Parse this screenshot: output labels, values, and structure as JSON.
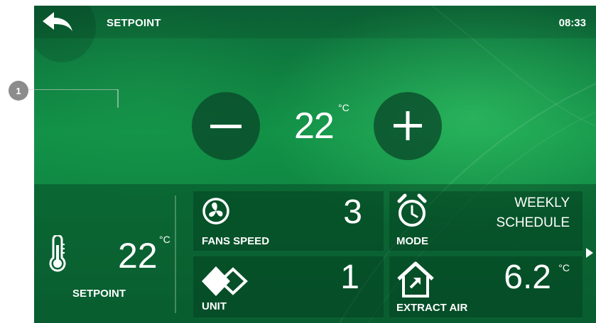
{
  "header": {
    "title": "SETPOINT",
    "time": "08:33"
  },
  "callout": {
    "number": "1"
  },
  "setpoint_control": {
    "value": "22",
    "unit": "°C"
  },
  "summary": {
    "setpoint_value": "22",
    "setpoint_unit": "°C",
    "setpoint_label": "SETPOINT"
  },
  "tiles": {
    "fans_speed": {
      "label": "FANS SPEED",
      "value": "3"
    },
    "mode": {
      "label": "MODE",
      "value_line1": "WEEKLY",
      "value_line2": "SCHEDULE"
    },
    "unit": {
      "label": "UNIT",
      "value": "1"
    },
    "extract_air": {
      "label": "EXTRACT AIR",
      "value": "6.2",
      "unit": "°C"
    }
  },
  "icons": {
    "back": "back-arrow-icon",
    "minus": "minus-icon",
    "plus": "plus-icon",
    "thermometer": "thermometer-icon",
    "fan": "fan-icon",
    "alarm_clock": "alarm-clock-icon",
    "unit": "diamond-unit-icon",
    "house": "house-icon",
    "next": "next-arrow-icon"
  }
}
